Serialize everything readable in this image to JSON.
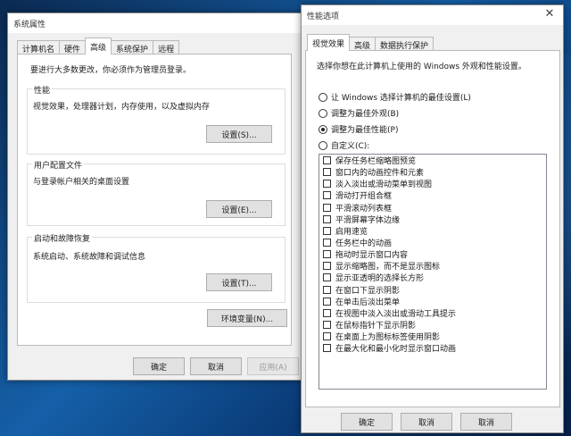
{
  "system_properties": {
    "title": "系统属性",
    "tabs": [
      "计算机名",
      "硬件",
      "高级",
      "系统保护",
      "远程"
    ],
    "admin_note": "要进行大多数更改，你必须作为管理员登录。",
    "performance": {
      "title": "性能",
      "description": "视觉效果，处理器计划，内存使用，以及虚拟内存",
      "settings_label": "设置(S)..."
    },
    "user_profiles": {
      "title": "用户配置文件",
      "description": "与登录帐户相关的桌面设置",
      "settings_label": "设置(E)..."
    },
    "startup_recovery": {
      "title": "启动和故障恢复",
      "description": "系统启动、系统故障和调试信息",
      "settings_label": "设置(T)..."
    },
    "env_vars_label": "环境变量(N)...",
    "ok_label": "确定",
    "cancel_label": "取消",
    "apply_label": "应用(A)"
  },
  "performance_options": {
    "title": "性能选项",
    "tabs": [
      "视觉效果",
      "高级",
      "数据执行保护"
    ],
    "prompt": "选择你想在此计算机上使用的 Windows 外观和性能设置。",
    "radios": [
      {
        "label": "让 Windows 选择计算机的最佳设置(L)",
        "checked": false
      },
      {
        "label": "调整为最佳外观(B)",
        "checked": false
      },
      {
        "label": "调整为最佳性能(P)",
        "checked": true
      },
      {
        "label": "自定义(C):",
        "checked": false
      }
    ],
    "effects": [
      "保存任务栏缩略图预览",
      "窗口内的动画控件和元素",
      "淡入淡出或滑动菜单到视图",
      "滑动打开组合框",
      "平滑滚动列表框",
      "平滑屏幕字体边缘",
      "启用速览",
      "任务栏中的动画",
      "拖动时显示窗口内容",
      "显示缩略图，而不是显示图标",
      "显示亚透明的选择长方形",
      "在窗口下显示阴影",
      "在单击后淡出菜单",
      "在视图中淡入淡出或滑动工具提示",
      "在鼠标指针下显示阴影",
      "在桌面上为图标标签使用阴影",
      "在最大化和最小化时显示窗口动画"
    ],
    "ok_label": "确定",
    "cancel_label": "取消",
    "apply_label": "取消"
  },
  "close_glyph": "✕"
}
